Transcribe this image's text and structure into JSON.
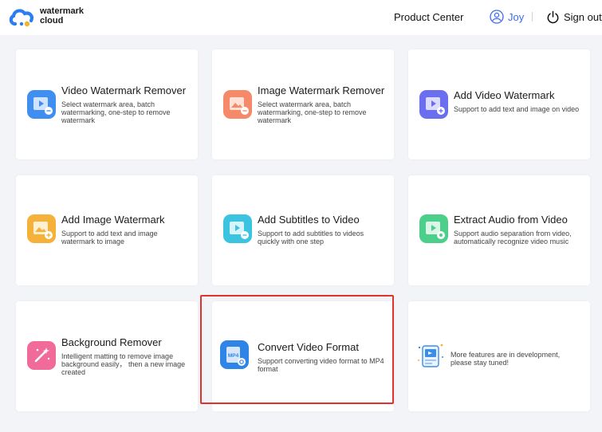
{
  "header": {
    "logo_line1": "watermark",
    "logo_line2": "cloud",
    "product_center": "Product Center",
    "user_name": "Joy",
    "sign_out": "Sign out",
    "accent_color": "#3b6cf0"
  },
  "cards": [
    {
      "title": "Video Watermark Remover",
      "desc": "Select watermark area, batch watermarking, one-step to remove watermark",
      "icon": "video-remove-icon",
      "color": "#3f8ef0"
    },
    {
      "title": "Image Watermark Remover",
      "desc": "Select watermark area, batch watermarking, one-step to remove watermark",
      "icon": "image-remove-icon",
      "color": "#f58a6a"
    },
    {
      "title": "Add Video Watermark",
      "desc": "Support to add text and image on video",
      "icon": "video-add-icon",
      "color": "#6c6ef0"
    },
    {
      "title": "Add Image Watermark",
      "desc": "Support to add text and image watermark to image",
      "icon": "image-add-icon",
      "color": "#f5b23a"
    },
    {
      "title": "Add Subtitles to Video",
      "desc": "Support to add subtitles to videos quickly with one step",
      "icon": "subtitle-icon",
      "color": "#3cc3e0"
    },
    {
      "title": "Extract Audio from Video",
      "desc": "Support audio separation from video, automatically recognize video music",
      "icon": "audio-extract-icon",
      "color": "#4ccf8a"
    },
    {
      "title": "Background Remover",
      "desc": "Intelligent matting to remove image background easily， then a new image created",
      "icon": "background-remove-icon",
      "color": "#f06a9a"
    },
    {
      "title": "Convert Video Format",
      "desc": "Support converting video format to MP4 format",
      "icon": "mp4-convert-icon",
      "color": "#2f84e8",
      "icon_text": "MP4"
    },
    {
      "title": "",
      "desc": "More features are in development, please stay tuned!",
      "icon": "coming-soon-icon",
      "color": "#3a8de8"
    }
  ]
}
